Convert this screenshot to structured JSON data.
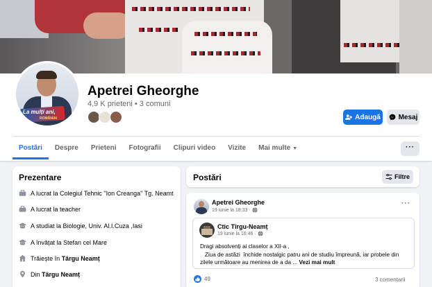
{
  "profile": {
    "name": "Apetrei Gheorghe",
    "stats": "4,9 K prieteni • 3 comuni",
    "avatar_banner": "La mulți ani,",
    "avatar_banner_sub": "ROMÂNIA!"
  },
  "actions": {
    "add_label": "Adaugă",
    "message_label": "Mesaj",
    "more_label": "···"
  },
  "tabs": [
    {
      "label": "Postări"
    },
    {
      "label": "Despre"
    },
    {
      "label": "Prieteni"
    },
    {
      "label": "Fotografii"
    },
    {
      "label": "Clipuri video"
    },
    {
      "label": "Vizite"
    },
    {
      "label": "Mai multe"
    }
  ],
  "intro": {
    "title": "Prezentare",
    "items": [
      {
        "text": "A lucrat la Colegiul Tehnic \"Ion Creanga\" Tg. Neamt",
        "icon": "briefcase-icon"
      },
      {
        "text": "A lucrat la teacher",
        "icon": "briefcase-icon"
      },
      {
        "text": "A studiat la Biologie, Univ. Al.I.Cuza ,Iasi",
        "icon": "graduation-cap-icon"
      },
      {
        "text": "A învățat la Stefan cel Mare",
        "icon": "graduation-cap-icon"
      },
      {
        "prefix": "Trăiește în ",
        "bold": "Târgu Neamț",
        "icon": "home-icon"
      },
      {
        "prefix": "Din ",
        "bold": "Târgu Neamț",
        "icon": "location-pin-icon"
      }
    ]
  },
  "posts": {
    "title": "Postări",
    "filter_label": "Filtre",
    "post": {
      "author": "Apetrei Gheorghe",
      "time": "19 iunie la 18:33 ·",
      "more": "···",
      "shared": {
        "author": "Ctic Tîrgu-Neamț",
        "time": "19 iunie la 16:46 ·",
        "line1": "Dragi  absolvenți ai claselor a XII-a ,",
        "line2": "   Ziua de astăzi  închide nostalgic patru ani de studiu împreună, iar probele din zilele următoare au menirea de a da ...",
        "see_more": "Vezi mai mult"
      },
      "likes": "49",
      "comments": "3 comentarii"
    }
  },
  "colors": {
    "accent": "#1b74e4",
    "secondary_text": "#65676b",
    "background": "#f0f2f5"
  }
}
